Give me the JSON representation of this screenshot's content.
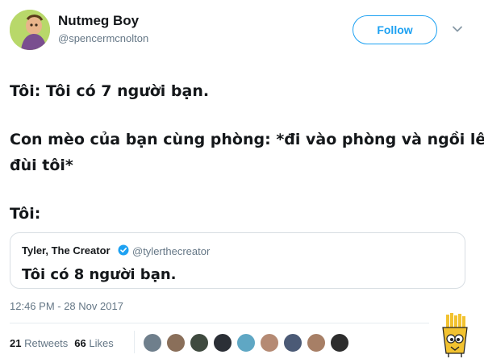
{
  "author": {
    "display_name": "Nutmeg Boy",
    "handle": "@spencermcnolton"
  },
  "header": {
    "follow_label": "Follow"
  },
  "tweet": {
    "lines": [
      "Tôi: Tôi có 7 người bạn.",
      "Con mèo của bạn cùng phòng: *đi vào phòng và ngồi lên",
      "đùi tôi*",
      "Tôi:"
    ]
  },
  "quoted_tweet": {
    "display_name": "Tyler, The Creator",
    "handle": "@tylerthecreator",
    "text": "Tôi có 8 người bạn."
  },
  "timestamp": "12:46 PM - 28 Nov 2017",
  "stats": {
    "retweets_count": "21",
    "retweets_label": "Retweets",
    "likes_count": "66",
    "likes_label": "Likes"
  },
  "colors": {
    "accent": "#1da1f2",
    "text_primary": "#14171a",
    "text_secondary": "#657786",
    "border": "#d8dee3"
  },
  "icons": {
    "follow_menu": "chevron-down-icon",
    "verified": "verified-badge-icon",
    "watermark": "fries-mascot-icon"
  },
  "likers": [
    {
      "color": "#6f7f8c"
    },
    {
      "color": "#8a6f5a"
    },
    {
      "color": "#3f4a3f"
    },
    {
      "color": "#2b2f36"
    },
    {
      "color": "#5fa7c4"
    },
    {
      "color": "#b58a74"
    },
    {
      "color": "#4b5a76"
    },
    {
      "color": "#a77f66"
    },
    {
      "color": "#2d2d2d"
    }
  ]
}
